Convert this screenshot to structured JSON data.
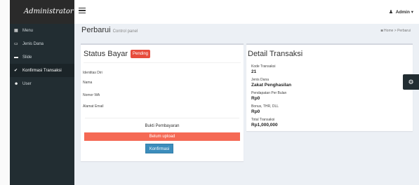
{
  "brand": "Administrator",
  "sidebar": {
    "items": [
      {
        "icon": "th-icon",
        "glyph": "▦",
        "label": "Menu"
      },
      {
        "icon": "credit-card-icon",
        "glyph": "▭",
        "label": "Jenis Dana"
      },
      {
        "icon": "image-icon",
        "glyph": "▬",
        "label": "Slide"
      },
      {
        "icon": "check-icon",
        "glyph": "✔",
        "label": "Konfirmasi Transaksi"
      },
      {
        "icon": "users-icon",
        "glyph": "☻",
        "label": "User"
      }
    ]
  },
  "topbar": {
    "user_label": "Admin",
    "caret": "▾"
  },
  "page": {
    "title": "Perbarui",
    "subtitle": "Control panel",
    "breadcrumb_home": "Home",
    "breadcrumb_sep": ">",
    "breadcrumb_current": "Perbarui"
  },
  "status": {
    "heading": "Status Bayar",
    "badge": "Pending",
    "badge_color": "#e74c3c",
    "identity_label": "Identitas Diri",
    "name_label": "Nama",
    "wa_label": "Nomor WA",
    "email_label": "Alamat Email",
    "proof_label": "Bukti Pembayaran",
    "no_upload_label": "Belum upload",
    "confirm_button": "Konfirmasi"
  },
  "detail": {
    "heading": "Detail Transaksi",
    "items": [
      {
        "label": "Kode Transaksi",
        "value": "21"
      },
      {
        "label": "Jenis Dana",
        "value": "Zakat Penghasilan"
      },
      {
        "label": "Pendapatan Per Bulan",
        "value": "Rp0"
      },
      {
        "label": "Bonus, THR, DLL",
        "value": "Rp0"
      },
      {
        "label": "Total Transaksi",
        "value": "Rp1,000,000"
      }
    ]
  },
  "colors": {
    "sidebar_bg": "#222d32",
    "accent_blue": "#3c8dbc",
    "danger": "#f56954"
  }
}
